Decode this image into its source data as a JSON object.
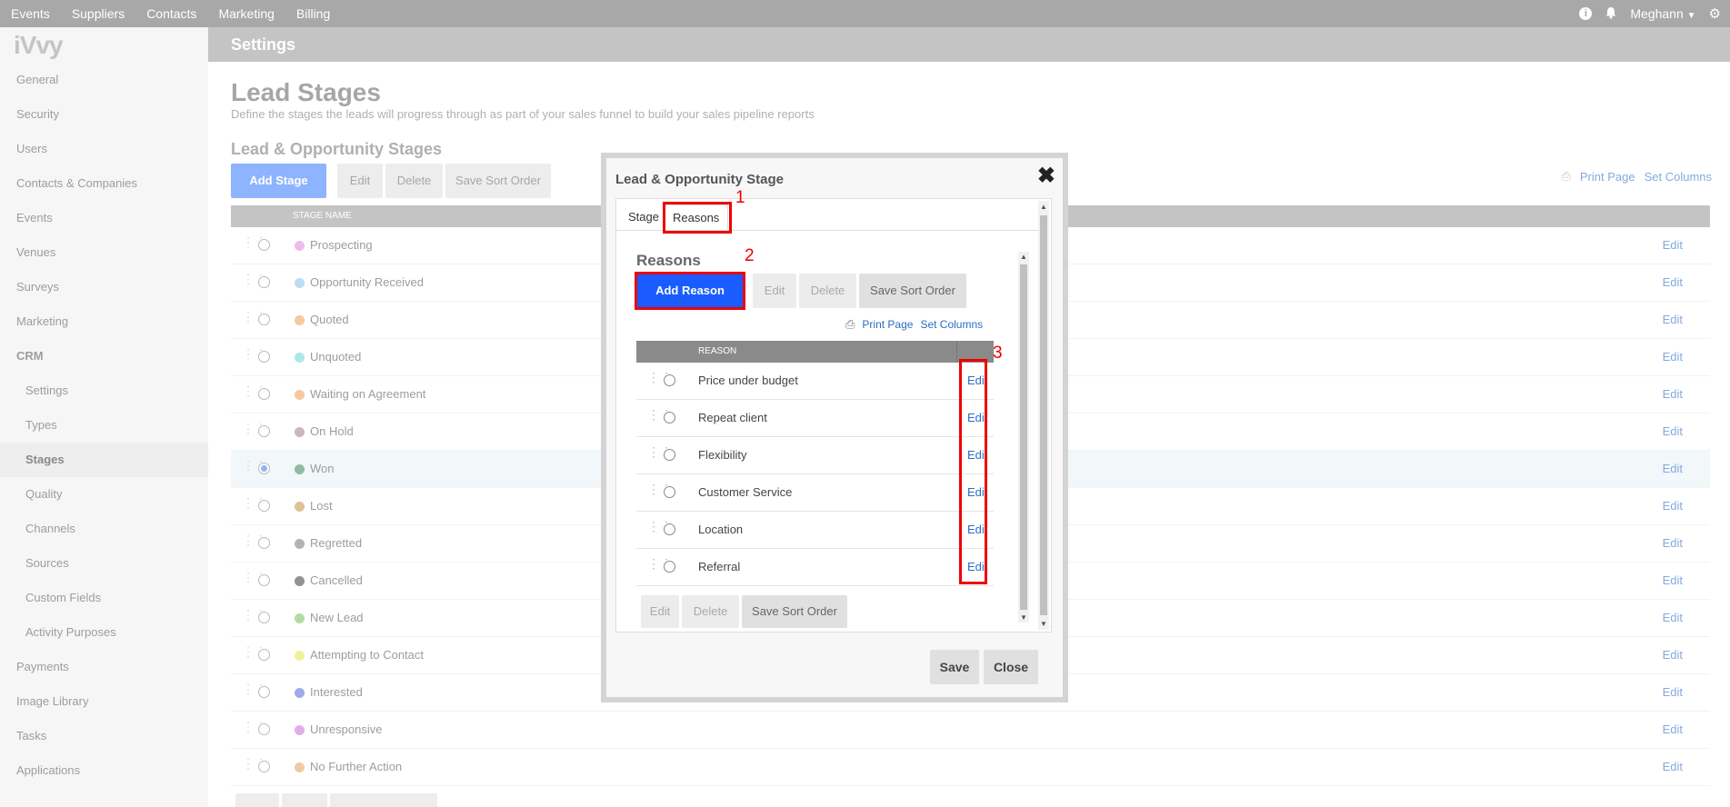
{
  "topnav": {
    "items": [
      "Events",
      "Suppliers",
      "Contacts",
      "Marketing",
      "Billing"
    ],
    "user": "Meghann",
    "icons": [
      "info-icon",
      "bell-icon",
      "gear-icon"
    ]
  },
  "sidebar": {
    "logo": "iVvy",
    "items": [
      {
        "label": "General"
      },
      {
        "label": "Security"
      },
      {
        "label": "Users"
      },
      {
        "label": "Contacts & Companies"
      },
      {
        "label": "Events"
      },
      {
        "label": "Venues"
      },
      {
        "label": "Surveys"
      },
      {
        "label": "Marketing"
      },
      {
        "label": "CRM"
      },
      {
        "label": "Settings"
      },
      {
        "label": "Types"
      },
      {
        "label": "Stages"
      },
      {
        "label": "Quality"
      },
      {
        "label": "Channels"
      },
      {
        "label": "Sources"
      },
      {
        "label": "Custom Fields"
      },
      {
        "label": "Activity Purposes"
      },
      {
        "label": "Payments"
      },
      {
        "label": "Image Library"
      },
      {
        "label": "Tasks"
      },
      {
        "label": "Applications"
      }
    ],
    "active": "Stages"
  },
  "header": {
    "settings": "Settings"
  },
  "page": {
    "title": "Lead Stages",
    "description": "Define the stages the leads will progress through as part of your sales funnel to build your sales pipeline reports",
    "section_title": "Lead & Opportunity Stages",
    "buttons": {
      "add": "Add Stage",
      "edit": "Edit",
      "delete": "Delete",
      "sort": "Save Sort Order"
    },
    "tools": {
      "print": "Print Page",
      "columns": "Set Columns"
    },
    "column": "STAGE NAME",
    "edit_label": "Edit",
    "stages": [
      {
        "name": "Prospecting",
        "color": "#e38be0"
      },
      {
        "name": "Opportunity Received",
        "color": "#8cc4ef"
      },
      {
        "name": "Quoted",
        "color": "#f0a35a"
      },
      {
        "name": "Unquoted",
        "color": "#6fd6d0"
      },
      {
        "name": "Waiting on Agreement",
        "color": "#f0a35a"
      },
      {
        "name": "On Hold",
        "color": "#a68490"
      },
      {
        "name": "Won",
        "color": "#3f8a62"
      },
      {
        "name": "Lost",
        "color": "#c8944f"
      },
      {
        "name": "Regretted",
        "color": "#7d7d7d"
      },
      {
        "name": "Cancelled",
        "color": "#444444"
      },
      {
        "name": "New Lead",
        "color": "#7ac35a"
      },
      {
        "name": "Attempting to Contact",
        "color": "#e6e84e"
      },
      {
        "name": "Interested",
        "color": "#5b6fd6"
      },
      {
        "name": "Unresponsive",
        "color": "#d070e0"
      },
      {
        "name": "No Further Action",
        "color": "#e0a860"
      }
    ],
    "selected_stage": "Won"
  },
  "modal": {
    "title": "Lead & Opportunity Stage",
    "tabs": [
      "Stage",
      "Reasons"
    ],
    "active_tab": "Reasons",
    "reasons_title": "Reasons",
    "buttons": {
      "add": "Add Reason",
      "edit": "Edit",
      "delete": "Delete",
      "sort": "Save Sort Order"
    },
    "tools": {
      "print": "Print Page",
      "columns": "Set Columns"
    },
    "column": "REASON",
    "edit_label": "Edit",
    "reasons": [
      "Price under budget",
      "Repeat client",
      "Flexibility",
      "Customer Service",
      "Location",
      "Referral"
    ],
    "footer": {
      "save": "Save",
      "close": "Close"
    },
    "annotations": [
      "1",
      "2",
      "3"
    ]
  }
}
